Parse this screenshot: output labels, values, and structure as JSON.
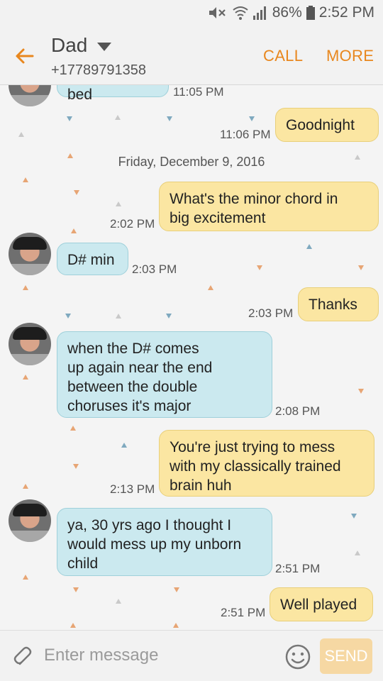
{
  "status": {
    "battery": "86%",
    "time": "2:52 PM"
  },
  "header": {
    "contact_name": "Dad",
    "contact_number": "+17789791358",
    "call_label": "CALL",
    "more_label": "MORE"
  },
  "conversation": {
    "date_separator": "Friday, December 9, 2016",
    "messages": [
      {
        "direction": "incoming",
        "text": "Ok, we in bed",
        "time": "11:05 PM"
      },
      {
        "direction": "outgoing",
        "text": "Goodnight",
        "time": "11:06 PM"
      },
      {
        "direction": "outgoing",
        "line1": "What's the minor chord in",
        "line2": "big excitement",
        "time": "2:02 PM"
      },
      {
        "direction": "incoming",
        "text": "D# min",
        "time": "2:03 PM"
      },
      {
        "direction": "outgoing",
        "text": "Thanks",
        "time": "2:03 PM"
      },
      {
        "direction": "incoming",
        "line1": "when the D# comes",
        "line2": "up again near the end",
        "line3": "between the double",
        "line4": "choruses it's major",
        "time": "2:08 PM"
      },
      {
        "direction": "outgoing",
        "line1": "You're just trying to mess",
        "line2": "with my classically trained",
        "line3": "brain huh",
        "time": "2:13 PM"
      },
      {
        "direction": "incoming",
        "line1": "ya, 30 yrs ago I thought I",
        "line2": "would mess up my unborn",
        "line3": "child",
        "time": "2:51 PM"
      },
      {
        "direction": "outgoing",
        "text": "Well played",
        "time": "2:51 PM"
      }
    ]
  },
  "composer": {
    "placeholder": "Enter message",
    "send_label": "SEND"
  },
  "colors": {
    "accent": "#e8871e",
    "incoming_bubble": "#cbe9ef",
    "outgoing_bubble": "#fbe6a2",
    "send_button": "#f6d8a3"
  },
  "icons": [
    "mute-icon",
    "wifi-icon",
    "signal-icon",
    "battery-icon",
    "back-arrow-icon",
    "dropdown-caret-icon",
    "paperclip-icon",
    "emoji-icon"
  ]
}
